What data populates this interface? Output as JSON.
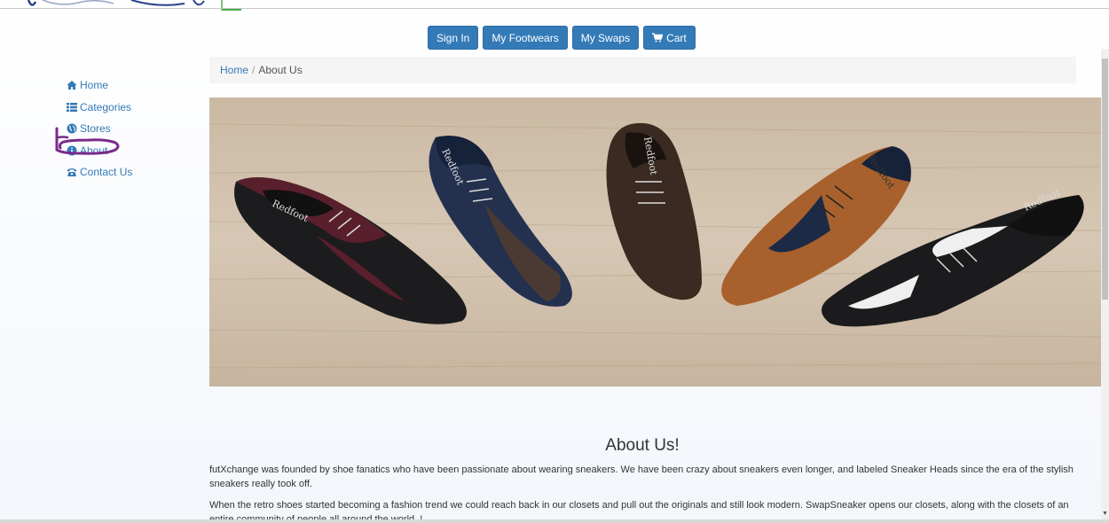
{
  "nav": {
    "sign_in": "Sign In",
    "my_footwears": "My Footwears",
    "my_swaps": "My Swaps",
    "cart": "Cart"
  },
  "sidebar": {
    "items": [
      {
        "label": "Home",
        "icon": "home-icon"
      },
      {
        "label": "Categories",
        "icon": "list-icon"
      },
      {
        "label": "Stores",
        "icon": "globe-icon"
      },
      {
        "label": "About",
        "icon": "info-icon"
      },
      {
        "label": "Contact Us",
        "icon": "phone-icon"
      }
    ]
  },
  "breadcrumb": {
    "home": "Home",
    "separator": "/",
    "current": "About Us"
  },
  "about": {
    "title": "About Us!",
    "paragraph1": "futXchange was founded by shoe fanatics who have been passionate about wearing sneakers. We have been crazy about sneakers even longer, and labeled Sneaker Heads since the era of the stylish sneakers really took off.",
    "paragraph2": "When the retro shoes started becoming a fashion trend we could reach back in our closets and pull out the originals and still look modern. SwapSneaker opens our closets, along with the closets of an entire community of people all around the world..!"
  },
  "colors": {
    "primary": "#337ab7",
    "annotation": "#7a2a8a"
  }
}
